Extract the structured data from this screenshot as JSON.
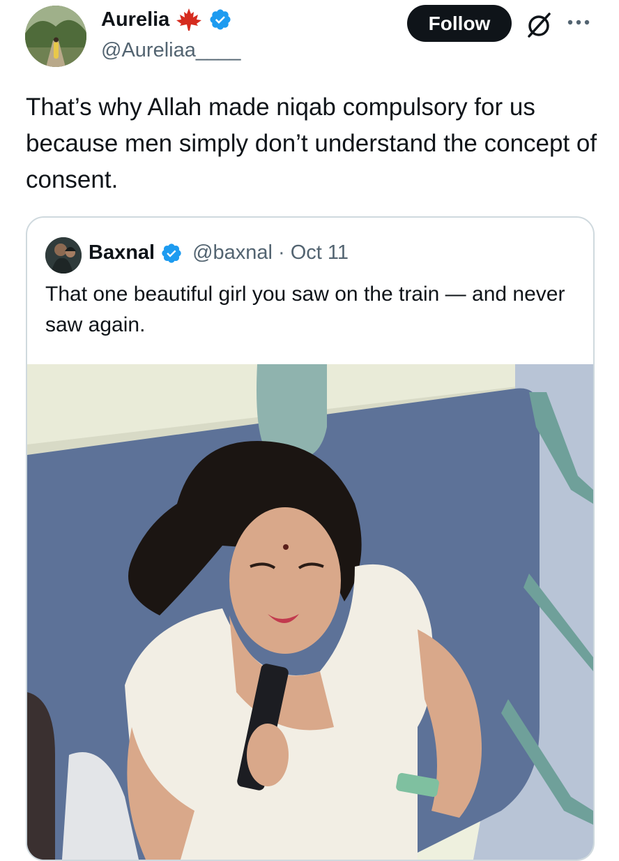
{
  "author": {
    "display_name": "Aurelia",
    "flag_emoji": "🍁",
    "handle": "@Aureliaa____",
    "verified": true
  },
  "actions": {
    "follow_label": "Follow",
    "grok_icon": "grok-icon",
    "more_icon": "more-icon"
  },
  "tweet": {
    "text": "That’s why Allah made niqab compulsory for us because men simply don’t understand the concept of consent."
  },
  "quoted": {
    "display_name": "Baxnal",
    "handle": "@baxnal",
    "separator": "·",
    "date": "Oct 11",
    "verified": true,
    "text": "That one beautiful girl you saw on the train — and never saw again."
  },
  "colors": {
    "verified_blue": "#1d9bf0",
    "text_primary": "#0f1419",
    "text_secondary": "#536471",
    "border": "#cfd9de",
    "maple_red": "#d52b1e"
  }
}
